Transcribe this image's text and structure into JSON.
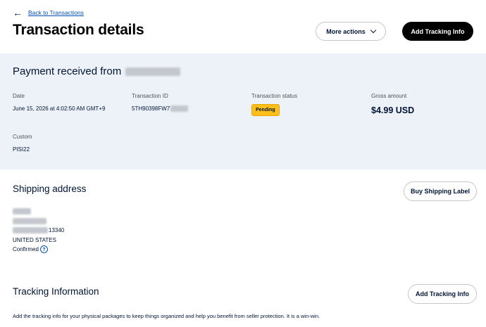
{
  "header": {
    "back_label": "Back to Transactions",
    "title": "Transaction details",
    "more_actions_label": "More actions",
    "add_tracking_label": "Add Tracking Info"
  },
  "payment": {
    "title_prefix": "Payment received from",
    "date_label": "Date",
    "date_value": "June 15, 2026 at 4:02:50 AM GMT+9",
    "txn_id_label": "Transaction ID",
    "txn_id_value": "5TH90398FW7",
    "status_label": "Transaction status",
    "status_value": "Pending",
    "gross_label": "Gross amount",
    "gross_value": "$4.99 USD",
    "custom_label": "Custom",
    "custom_value": "PISI22"
  },
  "shipping": {
    "title": "Shipping address",
    "button_label": "Buy Shipping Label",
    "zip_suffix": "13340",
    "country": "UNITED STATES",
    "confirmed": "Confirmed"
  },
  "tracking": {
    "title": "Tracking Information",
    "button_label": "Add Tracking Info",
    "description": "Add the tracking info for your physical packages to keep things organized and help you benefit from seller protection. It is a win-win."
  },
  "icons": {
    "back": "arrow-left-icon",
    "more": "chevron-down-icon",
    "help": "question-circle-icon"
  },
  "colors": {
    "status_pending": "#ffbf1a",
    "primary_button": "#000000",
    "panel_bg": "#edf1f8",
    "link": "#0551b5"
  }
}
